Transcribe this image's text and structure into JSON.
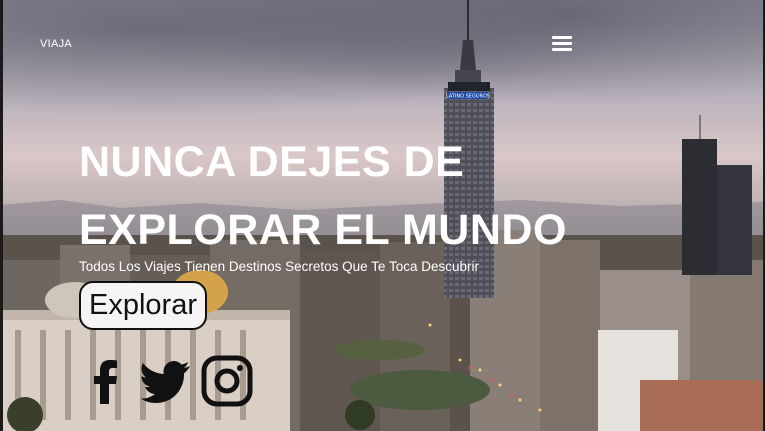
{
  "header": {
    "logo_text": "VIAJA",
    "menu_icon": "hamburger-menu-icon"
  },
  "hero": {
    "headline_line1": "NUNCA DEJES DE",
    "headline_line2": "EXPLORAR EL MUNDO",
    "subtitle": "Todos Los Viajes Tienen Destinos Secretos Que Te Toca Descubrir",
    "cta_label": "Explorar",
    "tower_sign": "LATINO SEGUROS"
  },
  "social": [
    {
      "icon": "facebook-icon"
    },
    {
      "icon": "twitter-icon"
    },
    {
      "icon": "instagram-icon"
    }
  ],
  "colors": {
    "text": "#ffffff",
    "button_bg": "#f6f4f4",
    "icon": "#111111"
  }
}
